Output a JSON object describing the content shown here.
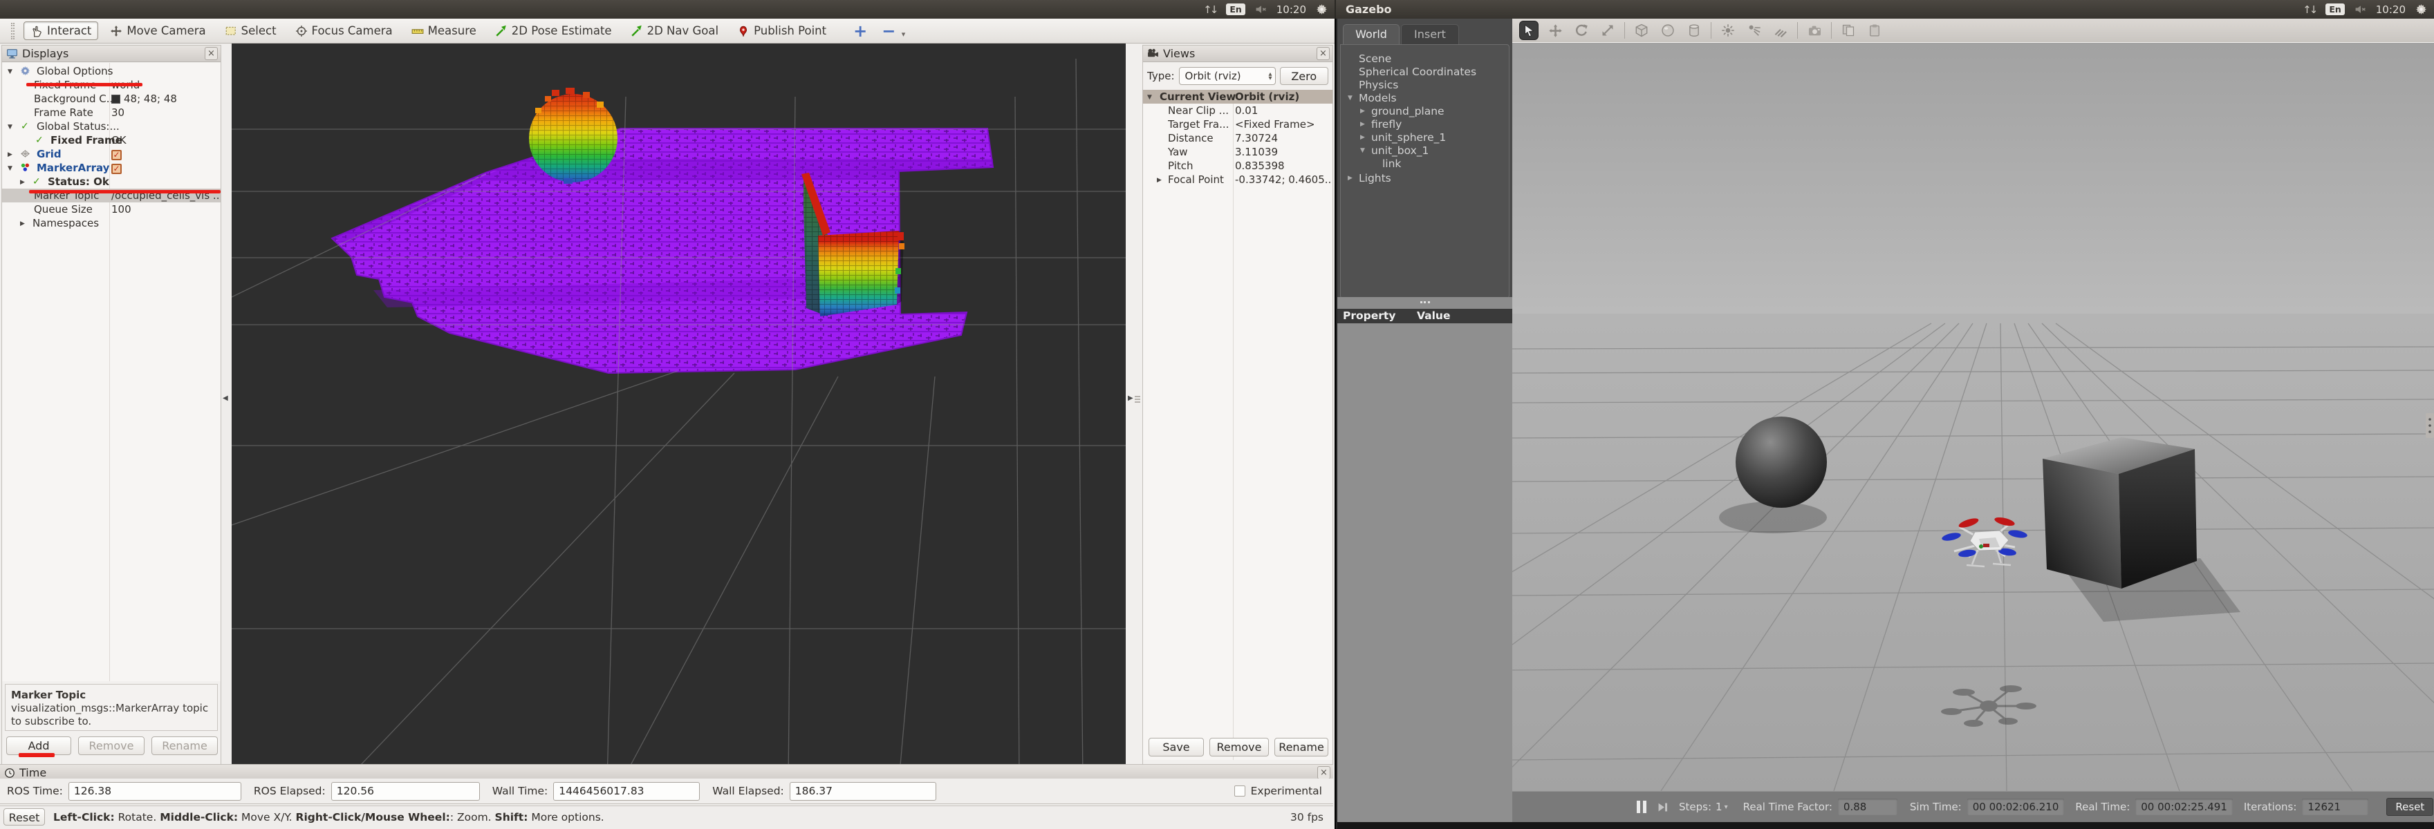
{
  "icons": {
    "network": "↑↓",
    "close": "×",
    "check": "✓",
    "dropdown": "▾",
    "expand_open": "▼",
    "expand_closed": "▶",
    "spin_up": "▲",
    "spin_down": "▼",
    "plus": "+",
    "minus": "−",
    "splitter_left": "◀",
    "splitter_right": "▶"
  },
  "topbar": {
    "window_title": "Gazebo",
    "clock": "10:20",
    "keyboard_layout": "En"
  },
  "rviz": {
    "tools": [
      {
        "label": "Interact"
      },
      {
        "label": "Move Camera"
      },
      {
        "label": "Select"
      },
      {
        "label": "Focus Camera"
      },
      {
        "label": "Measure"
      },
      {
        "label": "2D Pose Estimate"
      },
      {
        "label": "2D Nav Goal"
      },
      {
        "label": "Publish Point"
      }
    ],
    "displays": {
      "title": "Displays",
      "rows": [
        {
          "label": "Global Options",
          "value": ""
        },
        {
          "label": "Fixed Frame",
          "value": "world"
        },
        {
          "label": "Background C...",
          "value": "48; 48; 48"
        },
        {
          "label": "Frame Rate",
          "value": "30"
        },
        {
          "label": "Global Status:...",
          "value": ""
        },
        {
          "label": "Fixed Frame",
          "value": "OK"
        },
        {
          "label": "Grid",
          "value": ""
        },
        {
          "label": "MarkerArray",
          "value": ""
        },
        {
          "label": "Status: Ok",
          "value": ""
        },
        {
          "label": "Marker Topic",
          "value": "/occupied_cells_vis ..."
        },
        {
          "label": "Queue Size",
          "value": "100"
        },
        {
          "label": "Namespaces",
          "value": ""
        }
      ],
      "description_title": "Marker Topic",
      "description_body": "visualization_msgs::MarkerArray topic to subscribe to.",
      "add_button": "Add",
      "remove_button": "Remove",
      "rename_button": "Rename"
    },
    "views": {
      "title": "Views",
      "type_label": "Type:",
      "type_value": "Orbit (rviz)",
      "zero_button": "Zero",
      "current_view_label": "Current View",
      "current_view_value": "Orbit (rviz)",
      "rows": [
        {
          "label": "Near Clip ...",
          "value": "0.01"
        },
        {
          "label": "Target Fra...",
          "value": "<Fixed Frame>"
        },
        {
          "label": "Distance",
          "value": "7.30724"
        },
        {
          "label": "Yaw",
          "value": "3.11039"
        },
        {
          "label": "Pitch",
          "value": "0.835398"
        },
        {
          "label": "Focal Point",
          "value": "-0.33742; 0.4605..."
        }
      ],
      "save_button": "Save",
      "remove_button": "Remove",
      "rename_button": "Rename"
    },
    "time_panel": {
      "title": "Time",
      "fields": [
        {
          "label": "ROS Time:",
          "value": "126.38"
        },
        {
          "label": "ROS Elapsed:",
          "value": "120.56"
        },
        {
          "label": "Wall Time:",
          "value": "1446456017.83"
        },
        {
          "label": "Wall Elapsed:",
          "value": "186.37"
        }
      ],
      "experimental_label": "Experimental"
    },
    "statusbar": {
      "reset_button": "Reset",
      "help_segments": [
        {
          "text": "Left-Click:"
        },
        {
          "text": " Rotate.  "
        },
        {
          "text": "Middle-Click:"
        },
        {
          "text": " Move X/Y.  "
        },
        {
          "text": "Right-Click/Mouse Wheel:"
        },
        {
          "text": ": Zoom.  "
        },
        {
          "text": "Shift:"
        },
        {
          "text": " More options."
        }
      ],
      "fps": "30 fps"
    }
  },
  "gazebo": {
    "tabs": [
      {
        "label": "World"
      },
      {
        "label": "Insert"
      }
    ],
    "tree": [
      {
        "label": "Scene"
      },
      {
        "label": "Spherical Coordinates"
      },
      {
        "label": "Physics"
      },
      {
        "label": "Models"
      },
      {
        "label": "ground_plane"
      },
      {
        "label": "firefly"
      },
      {
        "label": "unit_sphere_1"
      },
      {
        "label": "unit_box_1"
      },
      {
        "label": "link"
      },
      {
        "label": "Lights"
      }
    ],
    "property_header": {
      "property": "Property",
      "value": "Value"
    },
    "statusbar": {
      "steps_label": "Steps:",
      "steps_value": "1",
      "rtf_label": "Real Time Factor:",
      "rtf_value": "0.88",
      "sim_time_label": "Sim Time:",
      "sim_time_value": "00 00:02:06.210",
      "real_time_label": "Real Time:",
      "real_time_value": "00 00:02:25.491",
      "iterations_label": "Iterations:",
      "iterations_value": "12621",
      "reset_button": "Reset"
    }
  },
  "colors": {
    "rviz_background": "#303030",
    "octomap_floor_purple": "#9b1cf0",
    "annotation_red": "#ea1c16",
    "rviz_background_value": "48; 48; 48"
  }
}
